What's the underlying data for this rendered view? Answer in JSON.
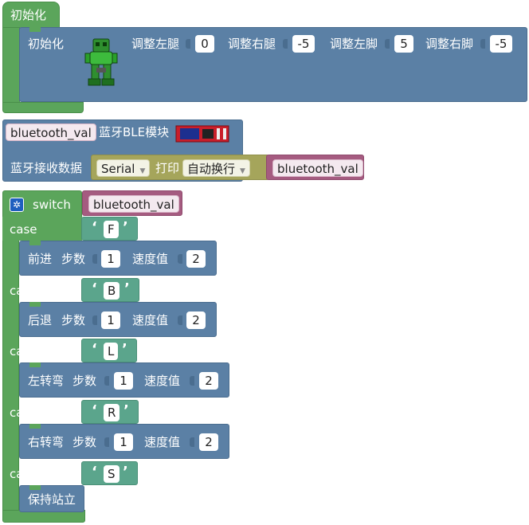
{
  "init_hat": {
    "label": "初始化"
  },
  "init_block": {
    "label": "初始化",
    "left_leg_label": "调整左腿",
    "left_leg_value": "0",
    "right_leg_label": "调整右腿",
    "right_leg_value": "-5",
    "left_foot_label": "调整左脚",
    "left_foot_value": "5",
    "right_foot_label": "调整右脚",
    "right_foot_value": "-5"
  },
  "ble_block": {
    "var_label": "bluetooth_val",
    "module_label": "蓝牙BLE模块",
    "receive_label": "蓝牙接收数据",
    "serial_value": "Serial",
    "print_label": "打印",
    "newline_value": "自动换行",
    "print_var": "bluetooth_val"
  },
  "switch_block": {
    "label": "switch",
    "var_label": "bluetooth_val",
    "cases": [
      {
        "case_label": "case",
        "value": "F",
        "action": "前进",
        "steps_label": "步数",
        "steps": "1",
        "speed_label": "速度值",
        "speed": "2"
      },
      {
        "case_label": "case",
        "value": "B",
        "action": "后退",
        "steps_label": "步数",
        "steps": "1",
        "speed_label": "速度值",
        "speed": "2"
      },
      {
        "case_label": "case",
        "value": "L",
        "action": "左转弯",
        "steps_label": "步数",
        "steps": "1",
        "speed_label": "速度值",
        "speed": "2"
      },
      {
        "case_label": "case",
        "value": "R",
        "action": "右转弯",
        "steps_label": "步数",
        "steps": "1",
        "speed_label": "速度值",
        "speed": "2"
      },
      {
        "case_label": "case",
        "value": "S",
        "action": "保持站立"
      }
    ]
  },
  "colors": {
    "control": "#5ba55b",
    "robot": "#5b80a5",
    "text": "#5ba58c",
    "variable": "#a55b80",
    "serial": "#a5a55b"
  }
}
